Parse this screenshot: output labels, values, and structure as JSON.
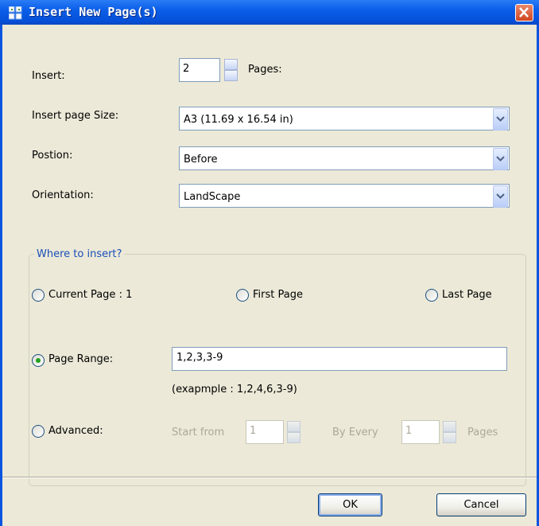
{
  "window": {
    "title": "Insert New Page(s)"
  },
  "form": {
    "insert_label": "Insert:",
    "insert_count": "2",
    "pages_label": "Pages:",
    "page_size_label": "Insert page Size:",
    "page_size_value": "A3 (11.69 x 16.54 in)",
    "position_label": "Postion:",
    "position_value": "Before",
    "orientation_label": "Orientation:",
    "orientation_value": "LandScape"
  },
  "where": {
    "group_title": "Where to insert?",
    "current_page_label": "Current Page : 1",
    "first_page_label": "First Page",
    "last_page_label": "Last Page",
    "page_range_label": "Page Range:",
    "page_range_value": "1,2,3,3-9",
    "page_range_example": "(exapmple : 1,2,4,6,3-9)",
    "advanced_label": "Advanced:",
    "start_from_label": "Start from",
    "start_from_value": "1",
    "by_every_label": "By Every",
    "by_every_value": "1",
    "pages_suffix": "Pages",
    "selected_option": "Page Range"
  },
  "buttons": {
    "ok": "OK",
    "cancel": "Cancel"
  },
  "icons": {
    "title": "insert-page-icon",
    "close": "close-icon",
    "dropdown": "chevron-down-icon"
  },
  "colors": {
    "titlebar": "#0b5ee8",
    "dialog_bg": "#ece9d8",
    "group_title": "#1a4fb8",
    "close": "#d0461f"
  }
}
